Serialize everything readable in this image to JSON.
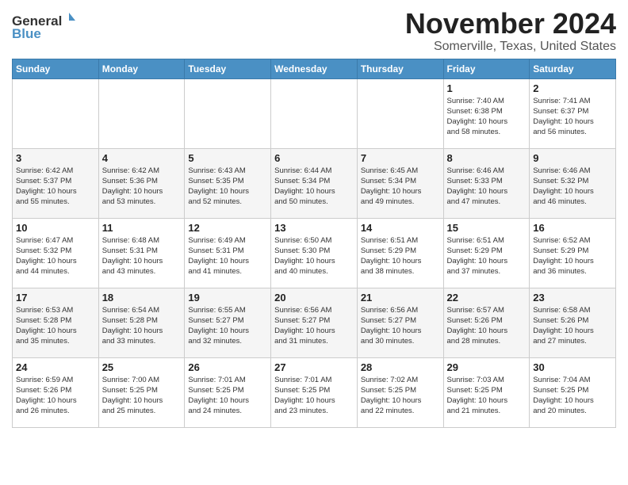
{
  "logo": {
    "line1": "General",
    "line2": "Blue",
    "sub": "Blue"
  },
  "title": "November 2024",
  "subtitle": "Somerville, Texas, United States",
  "days_of_week": [
    "Sunday",
    "Monday",
    "Tuesday",
    "Wednesday",
    "Thursday",
    "Friday",
    "Saturday"
  ],
  "weeks": [
    [
      {
        "day": "",
        "info": ""
      },
      {
        "day": "",
        "info": ""
      },
      {
        "day": "",
        "info": ""
      },
      {
        "day": "",
        "info": ""
      },
      {
        "day": "",
        "info": ""
      },
      {
        "day": "1",
        "info": "Sunrise: 7:40 AM\nSunset: 6:38 PM\nDaylight: 10 hours\nand 58 minutes."
      },
      {
        "day": "2",
        "info": "Sunrise: 7:41 AM\nSunset: 6:37 PM\nDaylight: 10 hours\nand 56 minutes."
      }
    ],
    [
      {
        "day": "3",
        "info": "Sunrise: 6:42 AM\nSunset: 5:37 PM\nDaylight: 10 hours\nand 55 minutes."
      },
      {
        "day": "4",
        "info": "Sunrise: 6:42 AM\nSunset: 5:36 PM\nDaylight: 10 hours\nand 53 minutes."
      },
      {
        "day": "5",
        "info": "Sunrise: 6:43 AM\nSunset: 5:35 PM\nDaylight: 10 hours\nand 52 minutes."
      },
      {
        "day": "6",
        "info": "Sunrise: 6:44 AM\nSunset: 5:34 PM\nDaylight: 10 hours\nand 50 minutes."
      },
      {
        "day": "7",
        "info": "Sunrise: 6:45 AM\nSunset: 5:34 PM\nDaylight: 10 hours\nand 49 minutes."
      },
      {
        "day": "8",
        "info": "Sunrise: 6:46 AM\nSunset: 5:33 PM\nDaylight: 10 hours\nand 47 minutes."
      },
      {
        "day": "9",
        "info": "Sunrise: 6:46 AM\nSunset: 5:32 PM\nDaylight: 10 hours\nand 46 minutes."
      }
    ],
    [
      {
        "day": "10",
        "info": "Sunrise: 6:47 AM\nSunset: 5:32 PM\nDaylight: 10 hours\nand 44 minutes."
      },
      {
        "day": "11",
        "info": "Sunrise: 6:48 AM\nSunset: 5:31 PM\nDaylight: 10 hours\nand 43 minutes."
      },
      {
        "day": "12",
        "info": "Sunrise: 6:49 AM\nSunset: 5:31 PM\nDaylight: 10 hours\nand 41 minutes."
      },
      {
        "day": "13",
        "info": "Sunrise: 6:50 AM\nSunset: 5:30 PM\nDaylight: 10 hours\nand 40 minutes."
      },
      {
        "day": "14",
        "info": "Sunrise: 6:51 AM\nSunset: 5:29 PM\nDaylight: 10 hours\nand 38 minutes."
      },
      {
        "day": "15",
        "info": "Sunrise: 6:51 AM\nSunset: 5:29 PM\nDaylight: 10 hours\nand 37 minutes."
      },
      {
        "day": "16",
        "info": "Sunrise: 6:52 AM\nSunset: 5:29 PM\nDaylight: 10 hours\nand 36 minutes."
      }
    ],
    [
      {
        "day": "17",
        "info": "Sunrise: 6:53 AM\nSunset: 5:28 PM\nDaylight: 10 hours\nand 35 minutes."
      },
      {
        "day": "18",
        "info": "Sunrise: 6:54 AM\nSunset: 5:28 PM\nDaylight: 10 hours\nand 33 minutes."
      },
      {
        "day": "19",
        "info": "Sunrise: 6:55 AM\nSunset: 5:27 PM\nDaylight: 10 hours\nand 32 minutes."
      },
      {
        "day": "20",
        "info": "Sunrise: 6:56 AM\nSunset: 5:27 PM\nDaylight: 10 hours\nand 31 minutes."
      },
      {
        "day": "21",
        "info": "Sunrise: 6:56 AM\nSunset: 5:27 PM\nDaylight: 10 hours\nand 30 minutes."
      },
      {
        "day": "22",
        "info": "Sunrise: 6:57 AM\nSunset: 5:26 PM\nDaylight: 10 hours\nand 28 minutes."
      },
      {
        "day": "23",
        "info": "Sunrise: 6:58 AM\nSunset: 5:26 PM\nDaylight: 10 hours\nand 27 minutes."
      }
    ],
    [
      {
        "day": "24",
        "info": "Sunrise: 6:59 AM\nSunset: 5:26 PM\nDaylight: 10 hours\nand 26 minutes."
      },
      {
        "day": "25",
        "info": "Sunrise: 7:00 AM\nSunset: 5:25 PM\nDaylight: 10 hours\nand 25 minutes."
      },
      {
        "day": "26",
        "info": "Sunrise: 7:01 AM\nSunset: 5:25 PM\nDaylight: 10 hours\nand 24 minutes."
      },
      {
        "day": "27",
        "info": "Sunrise: 7:01 AM\nSunset: 5:25 PM\nDaylight: 10 hours\nand 23 minutes."
      },
      {
        "day": "28",
        "info": "Sunrise: 7:02 AM\nSunset: 5:25 PM\nDaylight: 10 hours\nand 22 minutes."
      },
      {
        "day": "29",
        "info": "Sunrise: 7:03 AM\nSunset: 5:25 PM\nDaylight: 10 hours\nand 21 minutes."
      },
      {
        "day": "30",
        "info": "Sunrise: 7:04 AM\nSunset: 5:25 PM\nDaylight: 10 hours\nand 20 minutes."
      }
    ]
  ]
}
